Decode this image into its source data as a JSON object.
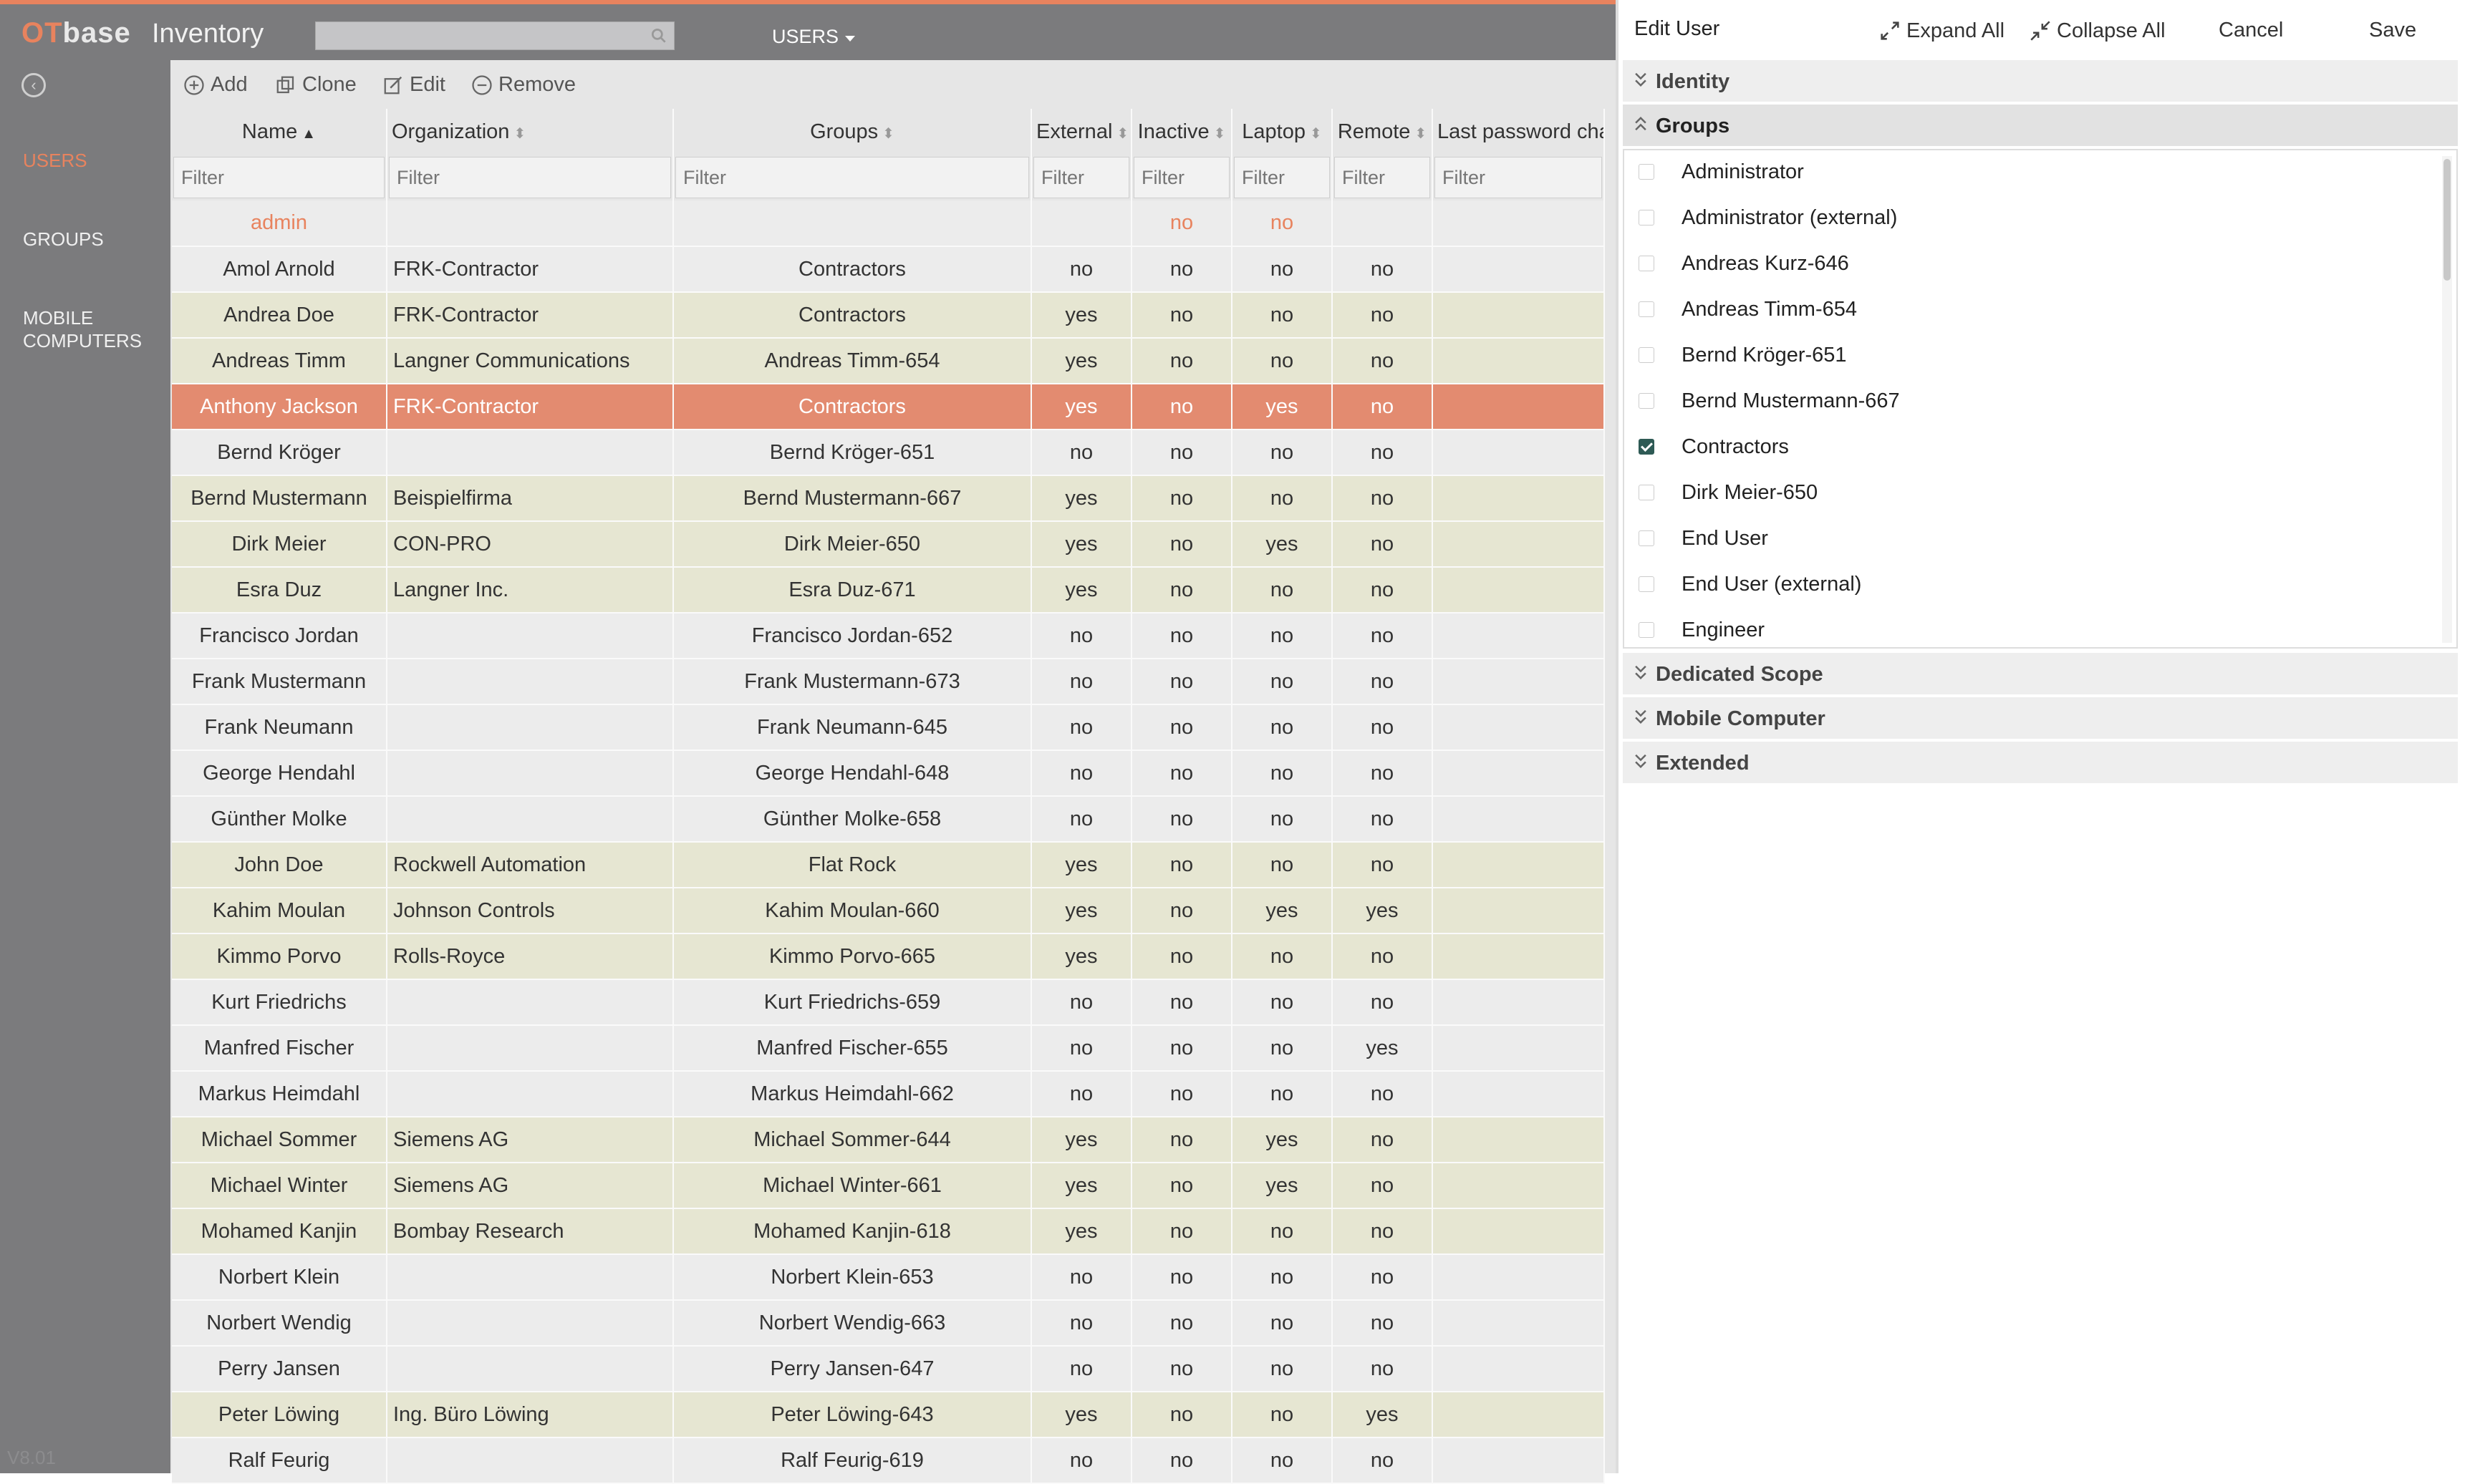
{
  "header": {
    "logo_ot": "OT",
    "logo_base": "base",
    "app_name": "Inventory",
    "search_placeholder": "",
    "module_label": "USERS"
  },
  "sidebar": {
    "items": [
      {
        "label": "USERS",
        "active": true
      },
      {
        "label": "GROUPS",
        "active": false
      },
      {
        "label": "MOBILE",
        "active": false
      },
      {
        "label": "COMPUTERS",
        "active": false
      }
    ],
    "version": "V8.01"
  },
  "toolbar": {
    "add": "Add",
    "clone": "Clone",
    "edit": "Edit",
    "remove": "Remove"
  },
  "table": {
    "columns": [
      "Name",
      "Organization",
      "Groups",
      "External",
      "Inactive",
      "Laptop",
      "Remote",
      "Last password cha"
    ],
    "filter_placeholder": "Filter",
    "rows": [
      {
        "name": "admin",
        "org": "",
        "groups": "",
        "external": "",
        "inactive": "no",
        "laptop": "no",
        "remote": "",
        "type": "admin"
      },
      {
        "name": "Amol Arnold",
        "org": "FRK-Contractor",
        "groups": "Contractors",
        "external": "no",
        "inactive": "no",
        "laptop": "no",
        "remote": "no",
        "type": "internal"
      },
      {
        "name": "Andrea Doe",
        "org": "FRK-Contractor",
        "groups": "Contractors",
        "external": "yes",
        "inactive": "no",
        "laptop": "no",
        "remote": "no",
        "type": "external"
      },
      {
        "name": "Andreas Timm",
        "org": "Langner Communications",
        "groups": "Andreas Timm-654",
        "external": "yes",
        "inactive": "no",
        "laptop": "no",
        "remote": "no",
        "type": "external"
      },
      {
        "name": "Anthony Jackson",
        "org": "FRK-Contractor",
        "groups": "Contractors",
        "external": "yes",
        "inactive": "no",
        "laptop": "yes",
        "remote": "no",
        "type": "selected"
      },
      {
        "name": "Bernd Kröger",
        "org": "",
        "groups": "Bernd Kröger-651",
        "external": "no",
        "inactive": "no",
        "laptop": "no",
        "remote": "no",
        "type": "internal"
      },
      {
        "name": "Bernd Mustermann",
        "org": "Beispielfirma",
        "groups": "Bernd Mustermann-667",
        "external": "yes",
        "inactive": "no",
        "laptop": "no",
        "remote": "no",
        "type": "external"
      },
      {
        "name": "Dirk Meier",
        "org": "CON-PRO",
        "groups": "Dirk Meier-650",
        "external": "yes",
        "inactive": "no",
        "laptop": "yes",
        "remote": "no",
        "type": "external"
      },
      {
        "name": "Esra Duz",
        "org": "Langner Inc.",
        "groups": "Esra Duz-671",
        "external": "yes",
        "inactive": "no",
        "laptop": "no",
        "remote": "no",
        "type": "external"
      },
      {
        "name": "Francisco Jordan",
        "org": "",
        "groups": "Francisco Jordan-652",
        "external": "no",
        "inactive": "no",
        "laptop": "no",
        "remote": "no",
        "type": "internal"
      },
      {
        "name": "Frank Mustermann",
        "org": "",
        "groups": "Frank Mustermann-673",
        "external": "no",
        "inactive": "no",
        "laptop": "no",
        "remote": "no",
        "type": "internal"
      },
      {
        "name": "Frank Neumann",
        "org": "",
        "groups": "Frank Neumann-645",
        "external": "no",
        "inactive": "no",
        "laptop": "no",
        "remote": "no",
        "type": "internal"
      },
      {
        "name": "George Hendahl",
        "org": "",
        "groups": "George Hendahl-648",
        "external": "no",
        "inactive": "no",
        "laptop": "no",
        "remote": "no",
        "type": "internal"
      },
      {
        "name": "Günther Molke",
        "org": "",
        "groups": "Günther Molke-658",
        "external": "no",
        "inactive": "no",
        "laptop": "no",
        "remote": "no",
        "type": "internal"
      },
      {
        "name": "John Doe",
        "org": "Rockwell Automation",
        "groups": "Flat Rock",
        "external": "yes",
        "inactive": "no",
        "laptop": "no",
        "remote": "no",
        "type": "external"
      },
      {
        "name": "Kahim Moulan",
        "org": "Johnson Controls",
        "groups": "Kahim Moulan-660",
        "external": "yes",
        "inactive": "no",
        "laptop": "yes",
        "remote": "yes",
        "type": "external"
      },
      {
        "name": "Kimmo Porvo",
        "org": "Rolls-Royce",
        "groups": "Kimmo Porvo-665",
        "external": "yes",
        "inactive": "no",
        "laptop": "no",
        "remote": "no",
        "type": "external"
      },
      {
        "name": "Kurt Friedrichs",
        "org": "",
        "groups": "Kurt Friedrichs-659",
        "external": "no",
        "inactive": "no",
        "laptop": "no",
        "remote": "no",
        "type": "internal"
      },
      {
        "name": "Manfred Fischer",
        "org": "",
        "groups": "Manfred Fischer-655",
        "external": "no",
        "inactive": "no",
        "laptop": "no",
        "remote": "yes",
        "type": "internal"
      },
      {
        "name": "Markus Heimdahl",
        "org": "",
        "groups": "Markus Heimdahl-662",
        "external": "no",
        "inactive": "no",
        "laptop": "no",
        "remote": "no",
        "type": "internal"
      },
      {
        "name": "Michael Sommer",
        "org": "Siemens AG",
        "groups": "Michael Sommer-644",
        "external": "yes",
        "inactive": "no",
        "laptop": "yes",
        "remote": "no",
        "type": "external"
      },
      {
        "name": "Michael Winter",
        "org": "Siemens AG",
        "groups": "Michael Winter-661",
        "external": "yes",
        "inactive": "no",
        "laptop": "yes",
        "remote": "no",
        "type": "external"
      },
      {
        "name": "Mohamed Kanjin",
        "org": "Bombay Research",
        "groups": "Mohamed Kanjin-618",
        "external": "yes",
        "inactive": "no",
        "laptop": "no",
        "remote": "no",
        "type": "external"
      },
      {
        "name": "Norbert Klein",
        "org": "",
        "groups": "Norbert Klein-653",
        "external": "no",
        "inactive": "no",
        "laptop": "no",
        "remote": "no",
        "type": "internal"
      },
      {
        "name": "Norbert Wendig",
        "org": "",
        "groups": "Norbert Wendig-663",
        "external": "no",
        "inactive": "no",
        "laptop": "no",
        "remote": "no",
        "type": "internal"
      },
      {
        "name": "Perry Jansen",
        "org": "",
        "groups": "Perry Jansen-647",
        "external": "no",
        "inactive": "no",
        "laptop": "no",
        "remote": "no",
        "type": "internal"
      },
      {
        "name": "Peter Löwing",
        "org": "Ing. Büro Löwing",
        "groups": "Peter Löwing-643",
        "external": "yes",
        "inactive": "no",
        "laptop": "no",
        "remote": "yes",
        "type": "external"
      },
      {
        "name": "Ralf Feurig",
        "org": "",
        "groups": "Ralf Feurig-619",
        "external": "no",
        "inactive": "no",
        "laptop": "no",
        "remote": "no",
        "type": "internal"
      }
    ]
  },
  "panel": {
    "title": "Edit User",
    "expand_all": "Expand All",
    "collapse_all": "Collapse All",
    "cancel": "Cancel",
    "save": "Save",
    "sections": {
      "identity": "Identity",
      "groups": "Groups",
      "dedicated_scope": "Dedicated Scope",
      "mobile_computer": "Mobile Computer",
      "extended": "Extended"
    },
    "group_options": [
      {
        "label": "Administrator",
        "checked": false
      },
      {
        "label": "Administrator (external)",
        "checked": false
      },
      {
        "label": "Andreas Kurz-646",
        "checked": false
      },
      {
        "label": "Andreas Timm-654",
        "checked": false
      },
      {
        "label": "Bernd Kröger-651",
        "checked": false
      },
      {
        "label": "Bernd Mustermann-667",
        "checked": false
      },
      {
        "label": "Contractors",
        "checked": true
      },
      {
        "label": "Dirk Meier-650",
        "checked": false
      },
      {
        "label": "End User",
        "checked": false
      },
      {
        "label": "End User (external)",
        "checked": false
      },
      {
        "label": "Engineer",
        "checked": false
      }
    ]
  },
  "colors": {
    "accent": "#e8835e",
    "chrome": "#7b7b7d",
    "selected_row": "#e38b70",
    "external_row": "#e6e6d2",
    "internal_row": "#ececec",
    "checkbox_on": "#2e5a55"
  },
  "icons": [
    "search-icon",
    "back-arrow-icon",
    "add-icon",
    "clone-icon",
    "edit-icon",
    "remove-icon",
    "sort-icon",
    "expand-icon",
    "collapse-icon",
    "chevron-down-icon",
    "chevron-up-icon",
    "caret-down-icon"
  ]
}
